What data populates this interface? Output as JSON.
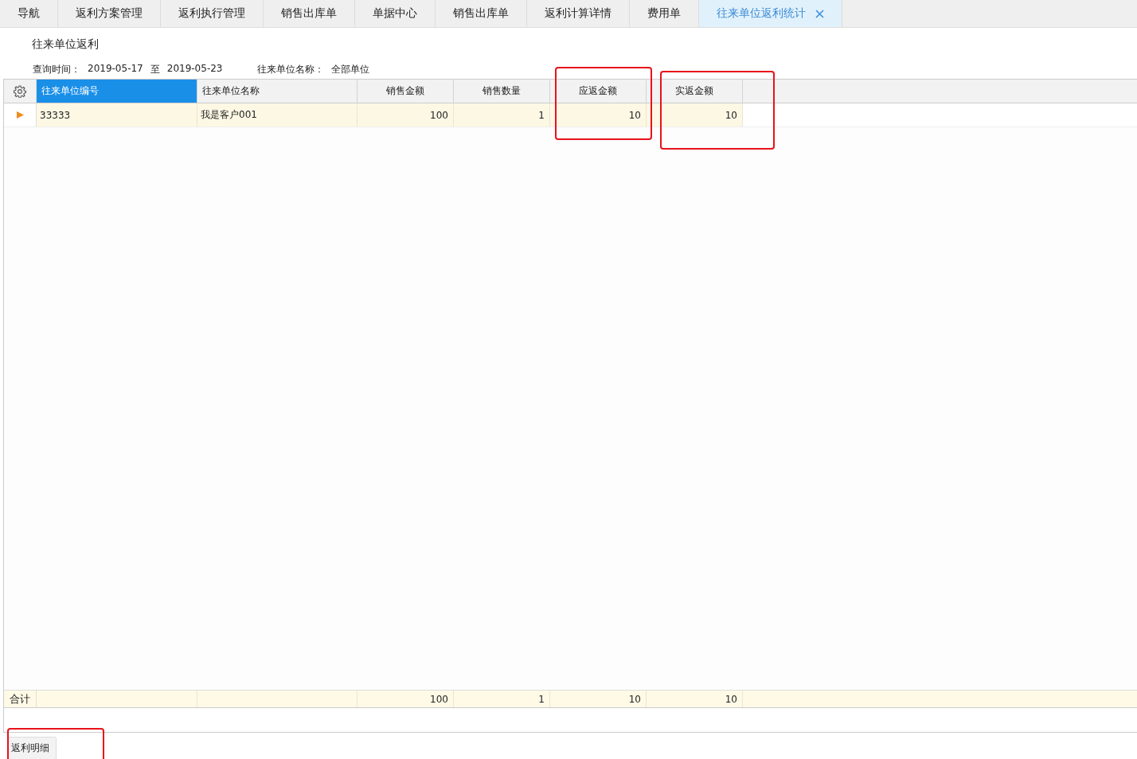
{
  "tabs": [
    {
      "label": "导航",
      "selected": false
    },
    {
      "label": "返利方案管理",
      "selected": false
    },
    {
      "label": "返利执行管理",
      "selected": false
    },
    {
      "label": "销售出库单",
      "selected": false
    },
    {
      "label": "单据中心",
      "selected": false
    },
    {
      "label": "销售出库单",
      "selected": false
    },
    {
      "label": "返利计算详情",
      "selected": false
    },
    {
      "label": "费用单",
      "selected": false
    },
    {
      "label": "往来单位返利统计",
      "selected": true,
      "closable": true
    }
  ],
  "page_title": "往来单位返利",
  "query": {
    "time_label": "查询时间：",
    "date_from": "2019-05-17",
    "date_sep": "至",
    "date_to": "2019-05-23",
    "unit_label": "往来单位名称：",
    "unit_value": "全部单位"
  },
  "table": {
    "columns": [
      {
        "label": "往来单位编号",
        "kind": "text",
        "selected": true
      },
      {
        "label": "往来单位名称",
        "kind": "text",
        "selected": false
      },
      {
        "label": "销售金额",
        "kind": "number",
        "selected": false
      },
      {
        "label": "销售数量",
        "kind": "number",
        "selected": false
      },
      {
        "label": "应返金额",
        "kind": "number",
        "selected": false
      },
      {
        "label": "实返金额",
        "kind": "number",
        "selected": false
      }
    ],
    "rows": [
      {
        "current": true,
        "cells": [
          "33333",
          "我是客户001",
          "100",
          "1",
          "10",
          "10"
        ]
      }
    ],
    "footer": {
      "label": "合计",
      "cells": [
        "",
        "",
        "100",
        "1",
        "10",
        "10"
      ]
    }
  },
  "button": "返利明细"
}
